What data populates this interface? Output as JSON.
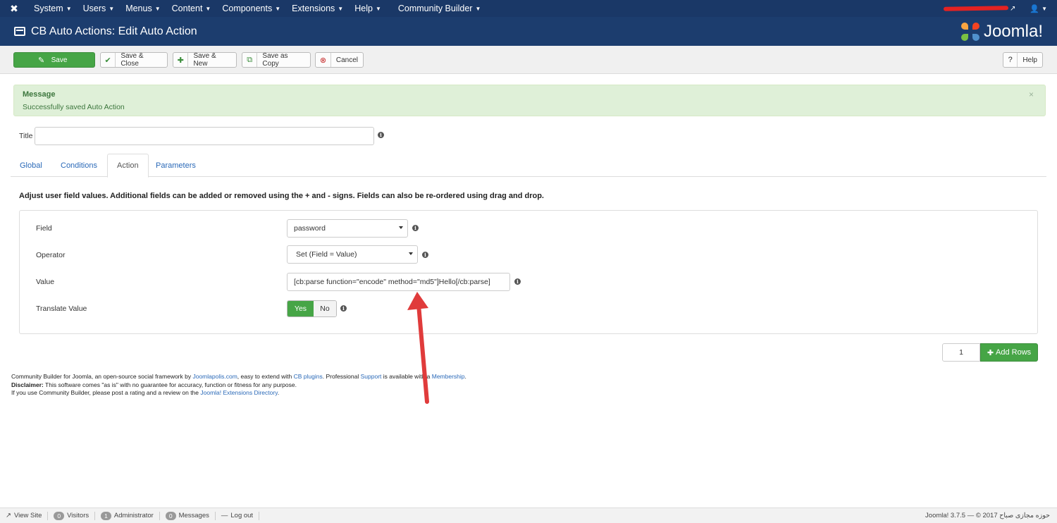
{
  "topbar": {
    "menus": [
      "System",
      "Users",
      "Menus",
      "Content",
      "Components",
      "Extensions",
      "Help",
      "Community Builder"
    ]
  },
  "header": {
    "title": "CB Auto Actions: Edit Auto Action",
    "brand": "Joomla!"
  },
  "toolbar": {
    "save": "Save",
    "save_close": "Save & Close",
    "save_new": "Save & New",
    "save_copy": "Save as Copy",
    "cancel": "Cancel",
    "help": "Help"
  },
  "message": {
    "heading": "Message",
    "text": "Successfully saved Auto Action",
    "close": "×"
  },
  "title_field": {
    "label": "Title",
    "value": ""
  },
  "tabs": [
    "Global",
    "Conditions",
    "Action",
    "Parameters"
  ],
  "action": {
    "description": "Adjust user field values. Additional fields can be added or removed using the + and - signs. Fields can also be re-ordered using drag and drop.",
    "field_label": "Field",
    "field_value": "password",
    "operator_label": "Operator",
    "operator_value": "Set (Field = Value)",
    "value_label": "Value",
    "value_value": "[cb:parse function=\"encode\" method=\"md5\"]Hello[/cb:parse]",
    "translate_label": "Translate Value",
    "yes": "Yes",
    "no": "No"
  },
  "rows": {
    "count": "1",
    "add_label": "Add Rows"
  },
  "footer": {
    "line1_a": "Community Builder for Joomla, an open-source social framework by ",
    "line1_link1": "Joomlapolis.com",
    "line1_b": ", easy to extend with ",
    "line1_link2": "CB plugins",
    "line1_c": ". Professional ",
    "line1_link3": "Support",
    "line1_d": " is available with a ",
    "line1_link4": "Membership",
    "line1_e": ".",
    "line2_bold": "Disclaimer:",
    "line2_text": " This software comes \"as is\" with no guarantee for accuracy, function or fitness for any purpose.",
    "line3_a": "If you use Community Builder, please post a rating and a review on the ",
    "line3_link": "Joomla! Extensions Directory",
    "line3_b": "."
  },
  "statusbar": {
    "view_site": "View Site",
    "visitors_count": "0",
    "visitors": "Visitors",
    "admin_count": "1",
    "admin": "Administrator",
    "messages_count": "0",
    "messages": "Messages",
    "logout": "Log out",
    "copyright": "Joomla! 3.7.5 — © 2017 حوزه مجازی صباح"
  },
  "colors": {
    "topbar": "#1a3867",
    "header": "#1c3d6e",
    "success": "#46a546",
    "link": "#2a69b8"
  }
}
